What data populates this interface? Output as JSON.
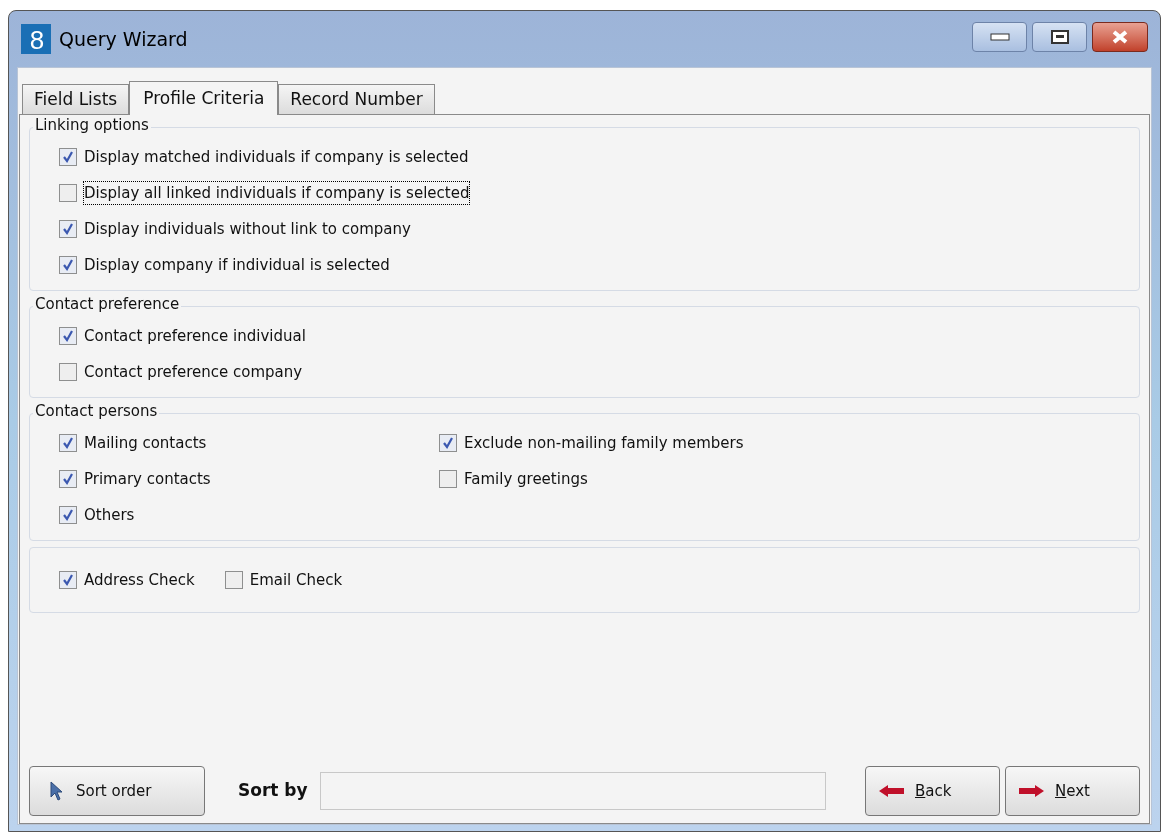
{
  "window": {
    "logo_text": "8",
    "title": "Query Wizard"
  },
  "tabs": [
    {
      "label": "Field Lists",
      "selected": false
    },
    {
      "label": "Profile Criteria",
      "selected": true
    },
    {
      "label": "Record Number",
      "selected": false
    }
  ],
  "groups": [
    {
      "title": "Linking options",
      "columns": [
        [
          {
            "label": "Display matched individuals if company is selected",
            "checked": true,
            "focused": false
          },
          {
            "label": "Display all linked individuals if company is selected",
            "checked": false,
            "focused": true
          },
          {
            "label": "Display individuals without link to company",
            "checked": true,
            "focused": false
          },
          {
            "label": "Display company if individual is selected",
            "checked": true,
            "focused": false
          }
        ]
      ]
    },
    {
      "title": "Contact preference",
      "columns": [
        [
          {
            "label": "Contact preference individual",
            "checked": true,
            "focused": false
          },
          {
            "label": "Contact preference company",
            "checked": false,
            "focused": false
          }
        ]
      ]
    },
    {
      "title": "Contact persons",
      "columns": [
        [
          {
            "label": "Mailing contacts",
            "checked": true,
            "focused": false
          },
          {
            "label": "Primary contacts",
            "checked": true,
            "focused": false
          },
          {
            "label": "Others",
            "checked": true,
            "focused": false
          }
        ],
        [
          {
            "label": "Exclude non-mailing family members",
            "checked": true,
            "focused": false
          },
          {
            "label": "Family greetings",
            "checked": false,
            "focused": false
          }
        ]
      ]
    }
  ],
  "checks": [
    {
      "label": "Address Check",
      "checked": true
    },
    {
      "label": "Email Check",
      "checked": false
    }
  ],
  "sort_order_button": "Sort order",
  "sort_by": {
    "label": "Sort by"
  },
  "nav_buttons": [
    {
      "label": "Back",
      "kind": "back",
      "mnemonic": true
    },
    {
      "label": "Next",
      "kind": "next",
      "mnemonic": true
    }
  ]
}
